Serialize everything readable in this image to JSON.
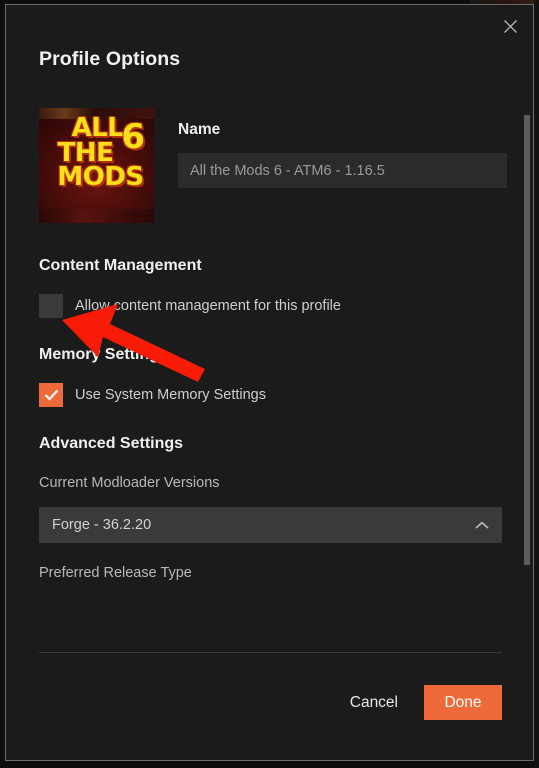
{
  "dialog": {
    "title": "Profile Options",
    "close_icon": "close-icon"
  },
  "profile": {
    "thumbnail_alt": "All the Mods 6 pack artwork",
    "thumbnail_lines": [
      "ALL",
      "THE",
      "MODS"
    ],
    "thumbnail_badge": "6",
    "name_label": "Name",
    "name_value": "All the Mods 6 - ATM6 - 1.16.5",
    "name_placeholder": "All the Mods 6 - ATM6 - 1.16.5"
  },
  "content_management": {
    "heading": "Content Management",
    "checkbox_label": "Allow content management for this profile",
    "checked": false
  },
  "memory_settings": {
    "heading": "Memory Settings",
    "checkbox_label": "Use System Memory Settings",
    "checked": true
  },
  "advanced_settings": {
    "heading": "Advanced Settings",
    "modloader_label": "Current Modloader Versions",
    "modloader_value": "Forge - 36.2.20",
    "modloader_chevron": "chevron-up-icon",
    "release_type_label": "Preferred Release Type"
  },
  "footer": {
    "cancel_label": "Cancel",
    "done_label": "Done"
  },
  "colors": {
    "accent": "#ef6a3a",
    "modal_bg": "#1b1b1b",
    "field_bg": "#3a3a3a",
    "input_bg": "#2b2b2b",
    "annotation_arrow": "#f81b06"
  },
  "annotation": {
    "type": "arrow",
    "points_to": "allow-content-management-checkbox"
  }
}
